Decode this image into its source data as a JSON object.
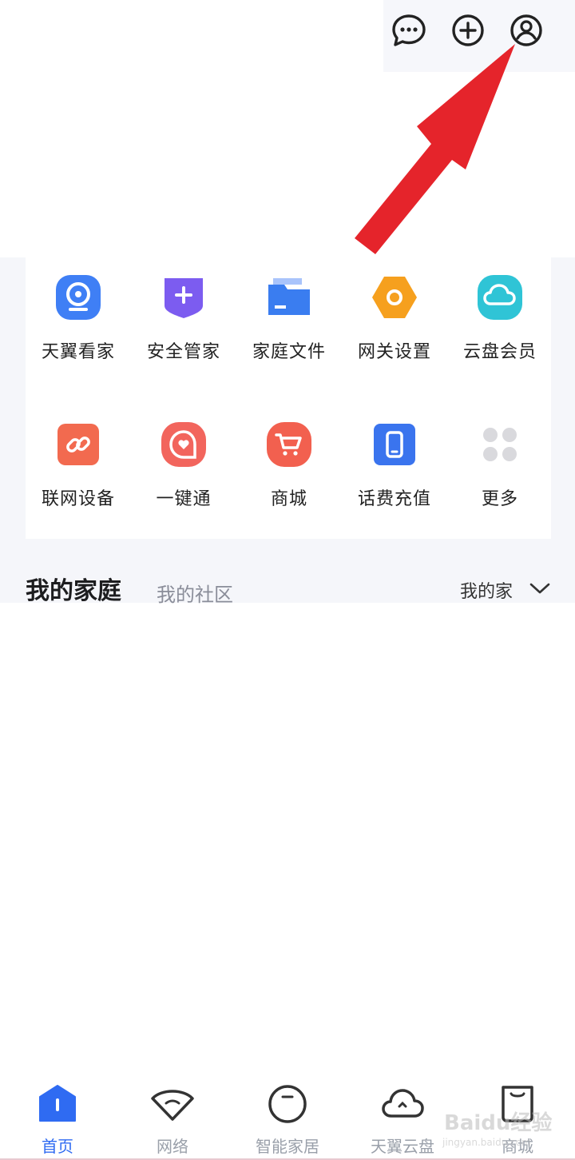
{
  "header": {
    "icons": [
      "message-icon",
      "add-icon",
      "user-icon"
    ]
  },
  "services": {
    "row1": [
      {
        "label": "天翼看家",
        "icon": "camera-icon",
        "color": "#3f7ff5"
      },
      {
        "label": "安全管家",
        "icon": "shield-plus-icon",
        "color": "#7c5cf0"
      },
      {
        "label": "家庭文件",
        "icon": "folder-icon",
        "color": "#3a7df0"
      },
      {
        "label": "网关设置",
        "icon": "gateway-icon",
        "color": "#f6a01e"
      },
      {
        "label": "云盘会员",
        "icon": "cloud-icon",
        "color": "#2fc4d6"
      }
    ],
    "row2": [
      {
        "label": "联网设备",
        "icon": "link-icon",
        "color": "#f26a4f"
      },
      {
        "label": "一键通",
        "icon": "heart-chat-icon",
        "color": "#f2655d"
      },
      {
        "label": "商城",
        "icon": "cart-icon",
        "color": "#f2604f"
      },
      {
        "label": "话费充值",
        "icon": "phone-icon",
        "color": "#3a74ee"
      },
      {
        "label": "更多",
        "icon": "more-icon",
        "color": "#d9d9dd"
      }
    ]
  },
  "family": {
    "title": "我的家庭",
    "subtitle": "我的社区",
    "selector": "我的家"
  },
  "tabs": [
    {
      "label": "首页",
      "icon": "home-icon",
      "active": true
    },
    {
      "label": "网络",
      "icon": "network-icon",
      "active": false
    },
    {
      "label": "智能家居",
      "icon": "smart-home-icon",
      "active": false
    },
    {
      "label": "天翼云盘",
      "icon": "cloud-disk-icon",
      "active": false
    },
    {
      "label": "商城",
      "icon": "shop-icon",
      "active": false
    }
  ],
  "watermark": {
    "brand": "Baidu经验",
    "url": "jingyan.baidu.com"
  },
  "colors": {
    "accent": "#2f6bf2",
    "arrow": "#e5242b"
  }
}
